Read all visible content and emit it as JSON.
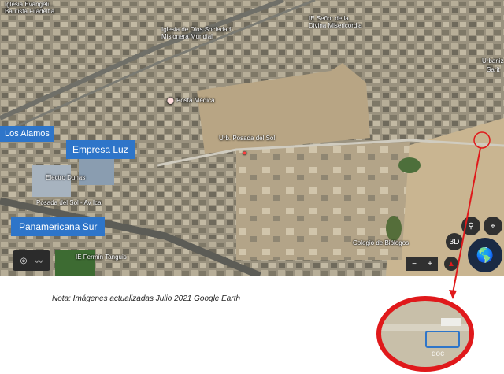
{
  "map": {
    "top_labels": [
      "Iglesia Evangeli...",
      "Bautista Filadelfia",
      "IE Señor de la",
      "Divina Misericordia",
      "Iglesia de Dios Sociedad",
      "Misionera Mundial",
      "Urbaniz",
      "Sarit"
    ],
    "places": {
      "posta_medica": "Posta Médica",
      "urb_posada": "Urb. Posada del Sol",
      "electro_dunas": "Electro Dunas",
      "posada_del_sol_ica": "Posada del Sol - Av Ica",
      "colegio_biologos": "Colegio de Biólogos",
      "ie_fermin": "IE Fermín Tanguis"
    },
    "callouts": {
      "los_alamos": "Los Alamos",
      "empresa_luz": "Empresa Luz",
      "panamericana": "Panamericana Sur"
    },
    "controls": {
      "three_d": "3D",
      "zoom_out": "−",
      "zoom_in": "+"
    }
  },
  "note": "Nota: Imágenes actualizadas Julio 2021 Google Earth",
  "watermark": "doc",
  "colors": {
    "callout": "#2e75c9",
    "highlight_ring": "#e0191b"
  }
}
